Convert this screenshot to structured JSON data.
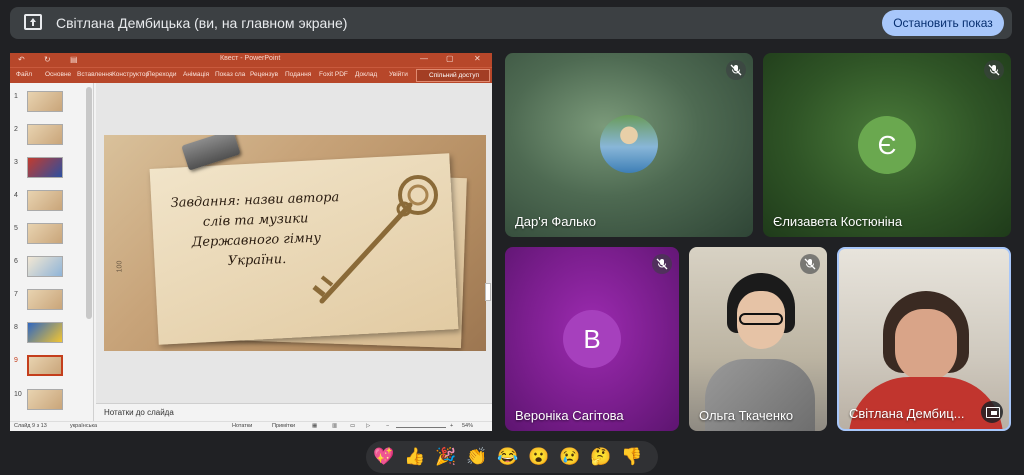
{
  "presenting_bar": {
    "title": "Світлана Дембицька (ви, на главном экране)",
    "stop_button": "Остановить показ"
  },
  "powerpoint": {
    "window_title": "Квест - PowerPoint",
    "ribbon_tabs": [
      "Файл",
      "Основне",
      "Вставлення",
      "Конструктор",
      "Переходи",
      "Анімація",
      "Показ сла",
      "Рецензув",
      "Подання",
      "Foxit PDF",
      "Доклад",
      "Увійти"
    ],
    "share_button": "Спільний доступ",
    "slide_numbers": [
      "1",
      "2",
      "3",
      "4",
      "5",
      "6",
      "7",
      "8",
      "9",
      "10"
    ],
    "selected_slide": "9",
    "slide_text": "Завдання: назви автора слів та музики Державного гімну України.",
    "ruler_label": "100",
    "notes_placeholder": "Нотатки до слайда",
    "status": {
      "slide_counter": "Слайд 9 з 13",
      "language": "українська",
      "notes_button": "Нотатки",
      "comments_button": "Примітки",
      "zoom": "54%"
    }
  },
  "participants": [
    {
      "name": "Дар'я Фалько",
      "muted": true,
      "avatar": "photo"
    },
    {
      "name": "Єлизавета Костюніна",
      "muted": true,
      "avatar_letter": "Є",
      "avatar_color": "#6aa84f"
    },
    {
      "name": "Вероніка Сагітова",
      "muted": true,
      "avatar_letter": "В",
      "avatar_color": "#a640bd"
    },
    {
      "name": "Ольга Ткаченко",
      "muted": true,
      "avatar": "video"
    },
    {
      "name": "Світлана Дембиц...",
      "muted": false,
      "avatar": "video",
      "pinned": true
    }
  ],
  "reactions": [
    "💖",
    "👍",
    "🎉",
    "👏",
    "😂",
    "😮",
    "😢",
    "🤔",
    "👎"
  ],
  "colors": {
    "background": "#202124",
    "stop_button_bg": "#a8c7fa",
    "ppt_accent": "#b7472a"
  }
}
